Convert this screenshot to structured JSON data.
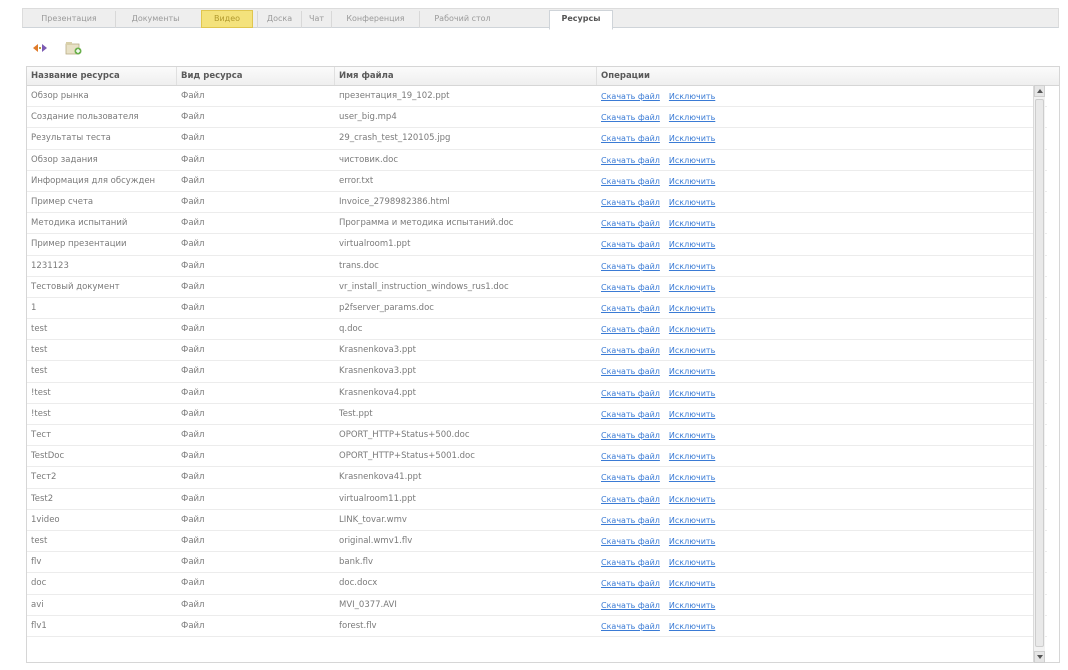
{
  "tabs": [
    {
      "label": "Презентация"
    },
    {
      "label": "Документы"
    },
    {
      "label": "Видео"
    },
    {
      "label": "Доска"
    },
    {
      "label": "Чат"
    },
    {
      "label": "Конференция"
    },
    {
      "label": "Рабочий стол"
    },
    {
      "label": "Ресурсы"
    }
  ],
  "active_tab": "Ресурсы",
  "toolbar": {
    "swap_icon": "swap-arrows-icon",
    "add_icon": "add-folder-icon"
  },
  "table": {
    "columns": [
      "Название ресурса",
      "Вид ресурса",
      "Имя файла",
      "Операции"
    ],
    "download_label": "Скачать файл",
    "exclude_label": "Исключить",
    "rows": [
      {
        "name": "Обзор рынка",
        "type": "Файл",
        "file": "презентация_19_102.ppt"
      },
      {
        "name": "Создание пользователя",
        "type": "Файл",
        "file": "user_big.mp4"
      },
      {
        "name": "Результаты теста",
        "type": "Файл",
        "file": "29_crash_test_120105.jpg"
      },
      {
        "name": "Обзор задания",
        "type": "Файл",
        "file": "чистовик.doc"
      },
      {
        "name": "Информация для обсужден",
        "type": "Файл",
        "file": "error.txt"
      },
      {
        "name": "Пример счета",
        "type": "Файл",
        "file": "Invoice_2798982386.html"
      },
      {
        "name": "Методика испытаний",
        "type": "Файл",
        "file": "Программа и методика испытаний.doc"
      },
      {
        "name": "Пример презентации",
        "type": "Файл",
        "file": "virtualroom1.ppt"
      },
      {
        "name": "1231123",
        "type": "Файл",
        "file": "trans.doc"
      },
      {
        "name": "Тестовый документ",
        "type": "Файл",
        "file": "vr_install_instruction_windows_rus1.doc"
      },
      {
        "name": "1",
        "type": "Файл",
        "file": "p2fserver_params.doc"
      },
      {
        "name": "test",
        "type": "Файл",
        "file": "q.doc"
      },
      {
        "name": "test",
        "type": "Файл",
        "file": "Krasnenkova3.ppt"
      },
      {
        "name": "test",
        "type": "Файл",
        "file": "Krasnenkova3.ppt"
      },
      {
        "name": "!test",
        "type": "Файл",
        "file": "Krasnenkova4.ppt"
      },
      {
        "name": "!test",
        "type": "Файл",
        "file": "Test.ppt"
      },
      {
        "name": "Тест",
        "type": "Файл",
        "file": "OPORT_HTTP+Status+500.doc"
      },
      {
        "name": "TestDoc",
        "type": "Файл",
        "file": "OPORT_HTTP+Status+5001.doc"
      },
      {
        "name": "Тест2",
        "type": "Файл",
        "file": "Krasnenkova41.ppt"
      },
      {
        "name": "Test2",
        "type": "Файл",
        "file": "virtualroom11.ppt"
      },
      {
        "name": "1video",
        "type": "Файл",
        "file": "LINK_tovar.wmv"
      },
      {
        "name": "test",
        "type": "Файл",
        "file": "original.wmv1.flv"
      },
      {
        "name": "flv",
        "type": "Файл",
        "file": "bank.flv"
      },
      {
        "name": "doc",
        "type": "Файл",
        "file": "doc.docx"
      },
      {
        "name": "avi",
        "type": "Файл",
        "file": "MVI_0377.AVI"
      },
      {
        "name": "flv1",
        "type": "Файл",
        "file": "forest.flv"
      }
    ]
  }
}
